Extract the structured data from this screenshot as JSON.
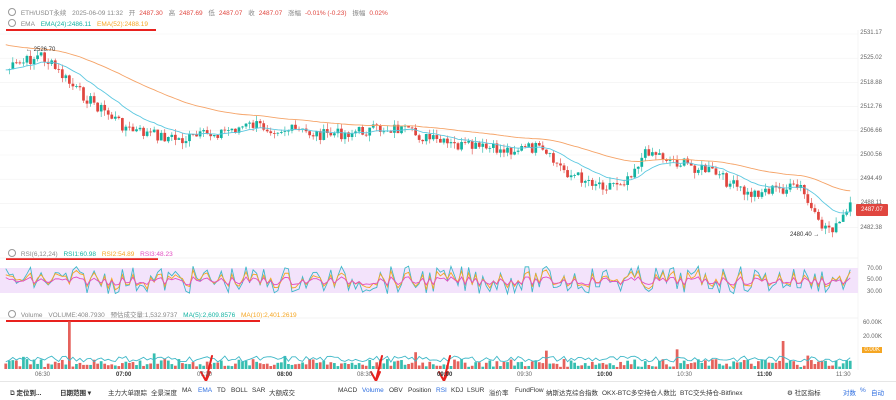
{
  "header": {
    "symbol": "ETH/USDT永续",
    "datetime": "2025-06-09 11:32",
    "open_label": "开",
    "open": "2487.30",
    "high_label": "高",
    "high": "2487.69",
    "low_label": "低",
    "low": "2487.07",
    "close_label": "收",
    "close": "2487.07",
    "change_label": "涨幅",
    "change": "-0.01% (-0.23)",
    "amp_label": "振幅",
    "amp": "0.02%"
  },
  "ema": {
    "name": "EMA",
    "ema24": "EMA(24):2486.11",
    "ema52": "EMA(52):2488.19"
  },
  "rsi": {
    "name": "RSI(6,12,24)",
    "rsi1": "RSI1:60.98",
    "rsi2": "RSI2:54.89",
    "rsi3": "RSI3:48.23"
  },
  "volume": {
    "name": "Volume",
    "vol": "VOLUME:408.7930",
    "amount": "预估成交量:1,532.9737",
    "ma5": "MA(5):2,609.8576",
    "ma10": "MA(10):2,401.2619"
  },
  "price_axis": [
    "2531.17",
    "2525.02",
    "2518.88",
    "2512.76",
    "2506.66",
    "2500.56",
    "2494.49",
    "2488.11",
    "2482.38"
  ],
  "rsi_axis": [
    "70.00",
    "50.00",
    "30.00"
  ],
  "vol_axis": [
    "60.00K",
    "20.00K",
    "0.00K"
  ],
  "current_price": "2487.07",
  "high_marker": "2526.70",
  "low_marker": "2480.40",
  "x_axis": [
    "06:30",
    "07:00",
    "07:30",
    "08:00",
    "08:30",
    "09:00",
    "09:30",
    "10:00",
    "10:30",
    "11:00",
    "11:30"
  ],
  "toolbar": {
    "settings": "定位到...",
    "range": "日期范围",
    "items_left": [
      "主力大单跟踪",
      "全景深度",
      "MA",
      "EMA",
      "TD",
      "BOLL",
      "SAR",
      "大额成交"
    ],
    "items_right": [
      "MACD",
      "Volume",
      "OBV",
      "Position",
      "RSI",
      "KDJ",
      "LSUR",
      "溢价率",
      "FundFlow",
      "纳斯达克综合指数",
      "OKX-BTC多空持仓人数比",
      "BTC交头持仓-Bitfinex"
    ],
    "indicator_lib": "社区指标",
    "compare": "对数",
    "percent": "%",
    "auto": "自动"
  },
  "colors": {
    "up": "#13b3a2",
    "down": "#e0463f",
    "ema24": "#5cc8e0",
    "ema52": "#f5a367",
    "annotation": "#e8211e"
  }
}
